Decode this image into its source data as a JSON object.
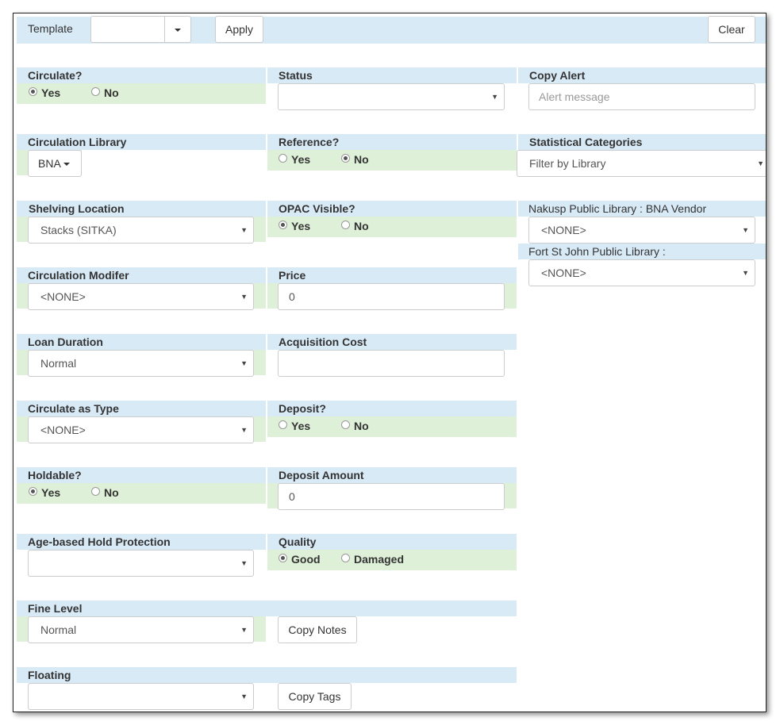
{
  "toolbar": {
    "template_label": "Template",
    "template_value": "",
    "apply_label": "Apply",
    "clear_label": "Clear"
  },
  "fields": {
    "circulate": {
      "label": "Circulate?",
      "opt1": "Yes",
      "opt2": "No",
      "selected": "Yes"
    },
    "status": {
      "label": "Status",
      "value": ""
    },
    "copy_alert": {
      "label": "Copy Alert",
      "placeholder": "Alert message"
    },
    "circulation_library": {
      "label": "Circulation Library",
      "value": "BNA"
    },
    "reference": {
      "label": "Reference?",
      "opt1": "Yes",
      "opt2": "No",
      "selected": "No"
    },
    "statistical_categories": {
      "label": "Statistical Categories",
      "filter_value": "Filter by Library"
    },
    "shelving_location": {
      "label": "Shelving Location",
      "value": "Stacks (SITKA)"
    },
    "opac_visible": {
      "label": "OPAC Visible?",
      "opt1": "Yes",
      "opt2": "No",
      "selected": "Yes"
    },
    "stat_cat_1": {
      "label": "Nakusp Public Library : BNA Vendor",
      "value": "<NONE>"
    },
    "stat_cat_2": {
      "label": "Fort St John Public Library :",
      "value": "<NONE>"
    },
    "circulation_modifier": {
      "label": "Circulation Modifer",
      "value": "<NONE>"
    },
    "price": {
      "label": "Price",
      "value": "0"
    },
    "loan_duration": {
      "label": "Loan Duration",
      "value": "Normal"
    },
    "acquisition_cost": {
      "label": "Acquisition Cost",
      "value": ""
    },
    "circulate_as_type": {
      "label": "Circulate as Type",
      "value": "<NONE>"
    },
    "deposit": {
      "label": "Deposit?",
      "opt1": "Yes",
      "opt2": "No",
      "selected": "none"
    },
    "holdable": {
      "label": "Holdable?",
      "opt1": "Yes",
      "opt2": "No",
      "selected": "Yes"
    },
    "deposit_amount": {
      "label": "Deposit Amount",
      "value": "0"
    },
    "age_hold_protection": {
      "label": "Age-based Hold Protection",
      "value": ""
    },
    "quality": {
      "label": "Quality",
      "opt1": "Good",
      "opt2": "Damaged",
      "selected": "Good"
    },
    "fine_level": {
      "label": "Fine Level",
      "value": "Normal"
    },
    "copy_notes": {
      "label": "Copy Notes"
    },
    "floating": {
      "label": "Floating",
      "value": ""
    },
    "copy_tags": {
      "label": "Copy Tags"
    }
  },
  "colors": {
    "header_blue": "#d9eaf7",
    "field_green": "#dff0d8"
  }
}
